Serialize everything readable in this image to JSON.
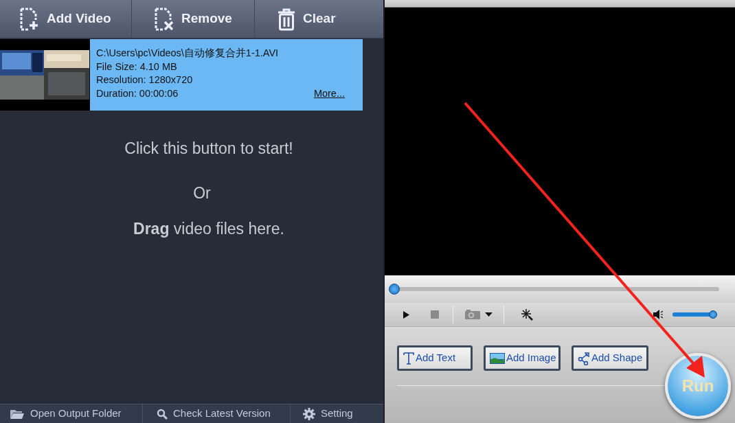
{
  "toolbar": [
    {
      "kind": "add",
      "label": "Add Video"
    },
    {
      "kind": "remove",
      "label": "Remove"
    },
    {
      "kind": "clear",
      "label": "Clear"
    }
  ],
  "videos": [
    {
      "path": "C:\\Users\\pc\\Videos\\自动修复合并1-1.AVI",
      "file_size": "File Size: 4.10 MB",
      "resolution": "Resolution: 1280x720",
      "duration": "Duration: 00:00:06",
      "more": "More...",
      "selected": true
    }
  ],
  "hint": {
    "line1": "Click this button to start!",
    "line2": "Or",
    "line3": "**Drag** video files here."
  },
  "player": {
    "seek": {
      "level": 0
    },
    "volume": {
      "level": 0.95
    }
  },
  "edit_buttons": [
    {
      "kind": "text",
      "label": "Add Text"
    },
    {
      "label": "Add Image"
    },
    {
      "kind": "shape",
      "label": "Add Shape"
    }
  ],
  "run_button": "Run",
  "status_bar": [
    {
      "kind": "folder",
      "label": "Open Output Folder"
    },
    {
      "kind": "search",
      "label": "Check Latest Version"
    },
    {
      "kind": "gear",
      "label": "Setting"
    }
  ]
}
